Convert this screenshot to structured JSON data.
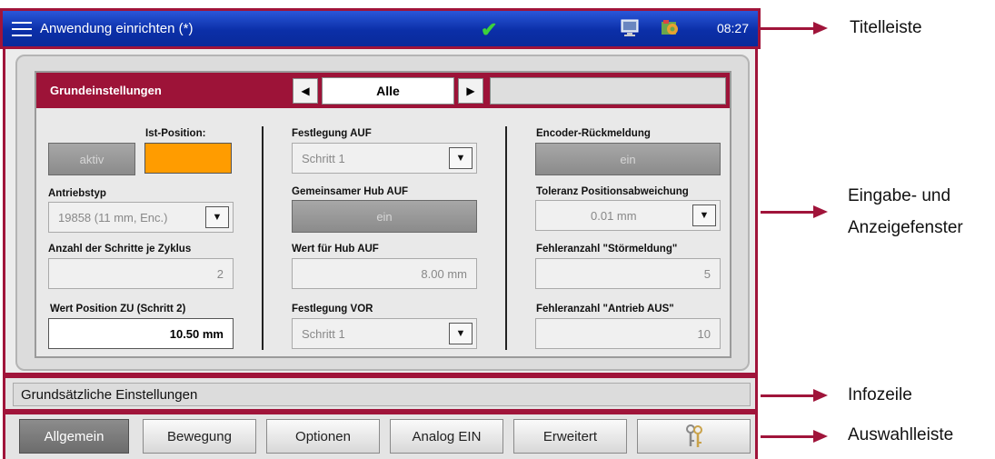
{
  "titlebar": {
    "title": "Anwendung einrichten (*)",
    "time": "08:27"
  },
  "header": {
    "title": "Grundeinstellungen",
    "filter_value": "Alle"
  },
  "col1": {
    "aktiv_button": "aktiv",
    "ist_position_label": "Ist-Position:",
    "antriebstyp_label": "Antriebstyp",
    "antriebstyp_value": "19858 (11 mm, Enc.)",
    "schritte_label": "Anzahl der Schritte je Zyklus",
    "schritte_value": "2",
    "wert_zu_label": "Wert Position ZU (Schritt 2)",
    "wert_zu_value": "10.50  mm"
  },
  "col2": {
    "festlegung_auf_label": "Festlegung AUF",
    "festlegung_auf_value": "Schritt 1",
    "hub_auf_label": "Gemeinsamer Hub AUF",
    "hub_auf_button": "ein",
    "wert_hub_label": "Wert für Hub AUF",
    "wert_hub_value": "8.00  mm",
    "festlegung_vor_label": "Festlegung VOR",
    "festlegung_vor_value": "Schritt 1"
  },
  "col3": {
    "encoder_label": "Encoder-Rückmeldung",
    "encoder_button": "ein",
    "toleranz_label": "Toleranz Positionsabweichung",
    "toleranz_value": "0.01  mm",
    "stoer_label": "Fehleranzahl \"Störmeldung\"",
    "stoer_value": "5",
    "antrieb_aus_label": "Fehleranzahl \"Antrieb AUS\"",
    "antrieb_aus_value": "10"
  },
  "infobar": {
    "text": "Grundsätzliche Einstellungen"
  },
  "tabs": [
    "Allgemein",
    "Bewegung",
    "Optionen",
    "Analog EIN",
    "Erweitert"
  ],
  "annotations": {
    "titelleiste": "Titelleiste",
    "eingabe_1": "Eingabe- und",
    "eingabe_2": "Anzeigefenster",
    "infozeile": "Infozeile",
    "auswahlleiste": "Auswahlleiste"
  },
  "colors": {
    "accent": "#a0143a",
    "titlebar": "#0b2fa8",
    "orange": "#ff9c00"
  },
  "icons": [
    "menu-icon",
    "check-icon",
    "monitor-icon",
    "config-icon",
    "keys-icon",
    "arrow-left-icon",
    "arrow-right-icon",
    "dropdown-arrow-icon"
  ]
}
